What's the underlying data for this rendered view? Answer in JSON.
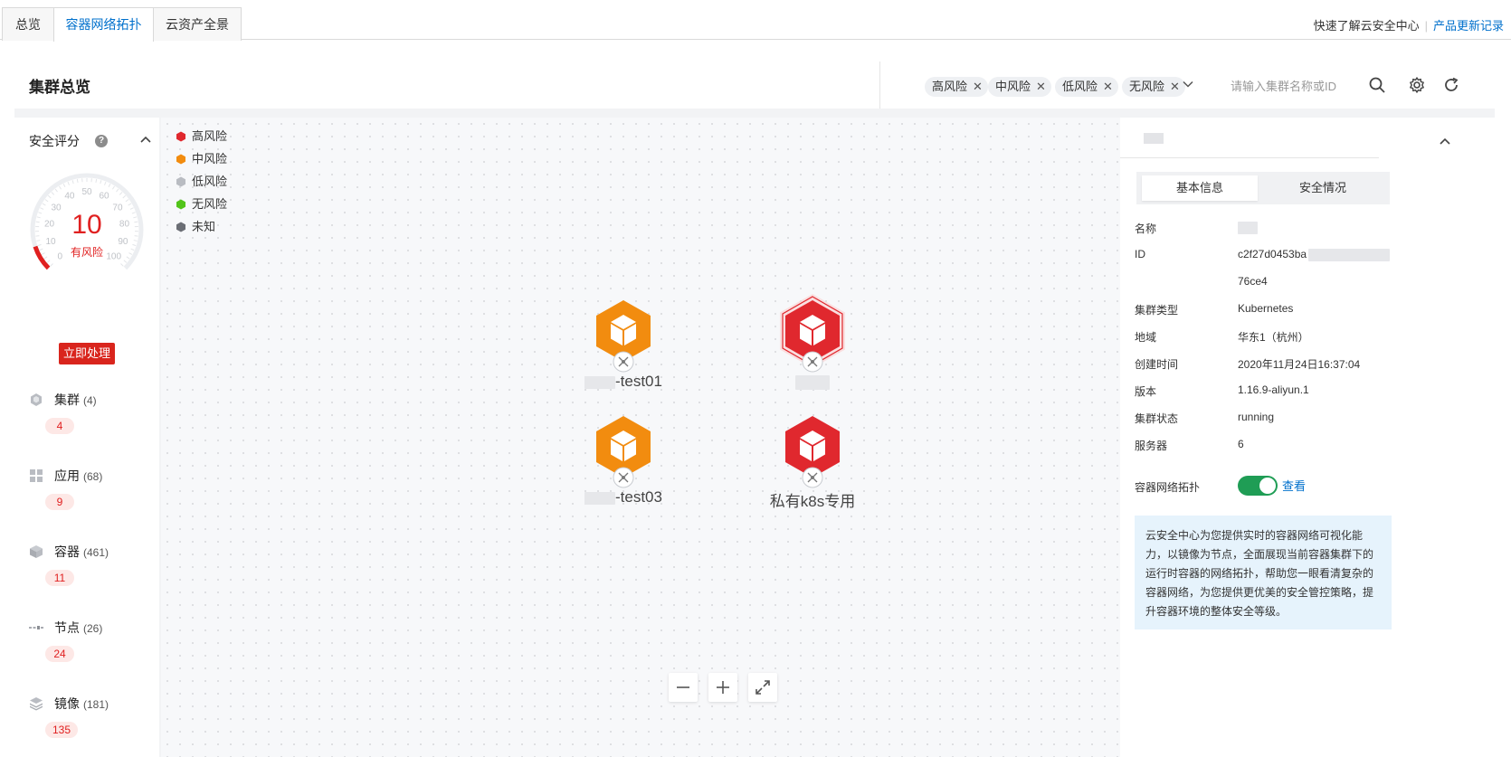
{
  "tabs": [
    {
      "label": "总览",
      "active": false
    },
    {
      "label": "容器网络拓扑",
      "active": true
    },
    {
      "label": "云资产全景",
      "active": false
    }
  ],
  "top_links": {
    "learn": "快速了解云安全中心",
    "changelog": "产品更新记录"
  },
  "header": {
    "title": "集群总览",
    "filters": [
      "高风险",
      "中风险",
      "低风险",
      "无风险"
    ],
    "search_placeholder": "请输入集群名称或ID"
  },
  "security_score": {
    "title": "安全评分",
    "value": "10",
    "label": "有风险",
    "gauge_ticks": [
      "0",
      "10",
      "20",
      "30",
      "40",
      "50",
      "60",
      "70",
      "80",
      "90",
      "100"
    ],
    "gauge_fraction": 0.1,
    "action_button": "立即处理"
  },
  "stats": [
    {
      "name": "集群",
      "count": "(4)",
      "risk": "4",
      "icon": "cluster-icon"
    },
    {
      "name": "应用",
      "count": "(68)",
      "risk": "9",
      "icon": "app-icon"
    },
    {
      "name": "容器",
      "count": "(461)",
      "risk": "11",
      "icon": "container-icon"
    },
    {
      "name": "节点",
      "count": "(26)",
      "risk": "24",
      "icon": "node-icon"
    },
    {
      "name": "镜像",
      "count": "(181)",
      "risk": "135",
      "icon": "image-icon"
    }
  ],
  "legend": [
    {
      "label": "高风险",
      "color": "#e0282e"
    },
    {
      "label": "中风险",
      "color": "#f28c0f"
    },
    {
      "label": "低风险",
      "color": "#b9bcc2"
    },
    {
      "label": "无风险",
      "color": "#52c41a"
    },
    {
      "label": "未知",
      "color": "#6b6e75"
    }
  ],
  "clusters": [
    {
      "label": "-test01",
      "risk": "medium",
      "color": "#f28c0f",
      "selected": false
    },
    {
      "label": "",
      "risk": "high",
      "color": "#e0282e",
      "selected": true
    },
    {
      "label": "-test03",
      "risk": "medium",
      "color": "#f28c0f",
      "selected": false
    },
    {
      "label": "私有k8s专用",
      "risk": "high",
      "color": "#e0282e",
      "selected": false
    }
  ],
  "detail": {
    "tabs": [
      "基本信息",
      "安全情况"
    ],
    "rows": [
      {
        "label": "名称",
        "value": ""
      },
      {
        "label": "ID",
        "value": "c2f27d0453ba"
      },
      {
        "label": "",
        "value": "76ce4"
      },
      {
        "label": "集群类型",
        "value": "Kubernetes"
      },
      {
        "label": "地域",
        "value": "华东1（杭州）"
      },
      {
        "label": "创建时间",
        "value": "2020年11月24日16:37:04"
      },
      {
        "label": "版本",
        "value": "1.16.9-aliyun.1"
      },
      {
        "label": "集群状态",
        "value": "running"
      },
      {
        "label": "服务器",
        "value": "6"
      }
    ],
    "topology_label": "容器网络拓扑",
    "topology_enabled": true,
    "view_link": "查看",
    "info": "云安全中心为您提供实时的容器网络可视化能力，以镜像为节点，全面展现当前容器集群下的运行时容器的网络拓扑，帮助您一眼看清复杂的容器网络，为您提供更优美的安全管控策略，提升容器环境的整体安全等级。"
  }
}
